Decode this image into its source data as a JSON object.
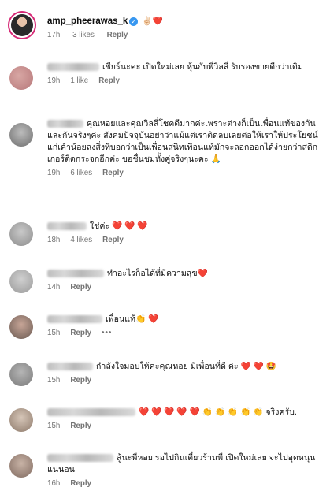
{
  "top": {
    "username": "amp_pheerawas_k",
    "emoji": "✌🏻❤️",
    "time": "17h",
    "likes": "3 likes",
    "reply": "Reply"
  },
  "comments": [
    {
      "text": "เชียร์นะคะ เปิดใหม่เลย หุ้นกับพี่วิลลี่ รับรองขายดีกว่าเดิม",
      "time": "19h",
      "likes": "1 like",
      "reply": "Reply"
    },
    {
      "text": "คุณหอยและคุณวิลลี่โชคดีมากค่ะเพราะต่างก็เป็นเพื่อนแท้ของกันและกันจริงๆค่ะ สังคมปัจจุบันอย่าว่าแม้แต่เราติดลบเลยต่อให้เราให้ประโยชน์แก่เค้าน้อยลงสิ่งที่บอกว่าเป็นเพื่อนสนิทเพื่อนแท้มักจะลอกออกได้ง่ายกว่าสติกเกอร์ติดกระจกอีกค่ะ ขอชื่นชมทั้งคู่จริงๆนะคะ 🙏",
      "time": "19h",
      "likes": "6 likes",
      "reply": "Reply"
    },
    {
      "text": "ใช่ค่ะ ❤️ ❤️ ❤️",
      "time": "18h",
      "likes": "4 likes",
      "reply": "Reply"
    },
    {
      "text": "ทำอะไรก็อได้ที่มีความสุข❤️",
      "time": "14h",
      "likes": "",
      "reply": "Reply"
    },
    {
      "text": "เพื่อนแท้👏 ❤️",
      "time": "15h",
      "likes": "",
      "reply": "Reply",
      "more": "•••"
    },
    {
      "text": "กำลังใจมอบให้ค่ะคุณหอย มีเพื่อนที่ดี ค่ะ ❤️ ❤️ 🤩",
      "time": "15h",
      "likes": "",
      "reply": "Reply"
    },
    {
      "text": "❤️ ❤️ ❤️ ❤️ ❤️ 👏 👏 👏 👏 👏 จริงครับ.",
      "time": "15h",
      "likes": "",
      "reply": "Reply"
    },
    {
      "text": "สู้นะพี่หอย รอไปกินเตี๋ยวร้านพี่ เปิดใหม่เลย จะไปอุดหนุนแน่นอน",
      "time": "16h",
      "likes": "",
      "reply": "Reply"
    }
  ],
  "colors": {
    "accent_ring": "#d62976",
    "verified": "#3897f0",
    "meta": "#737373"
  }
}
